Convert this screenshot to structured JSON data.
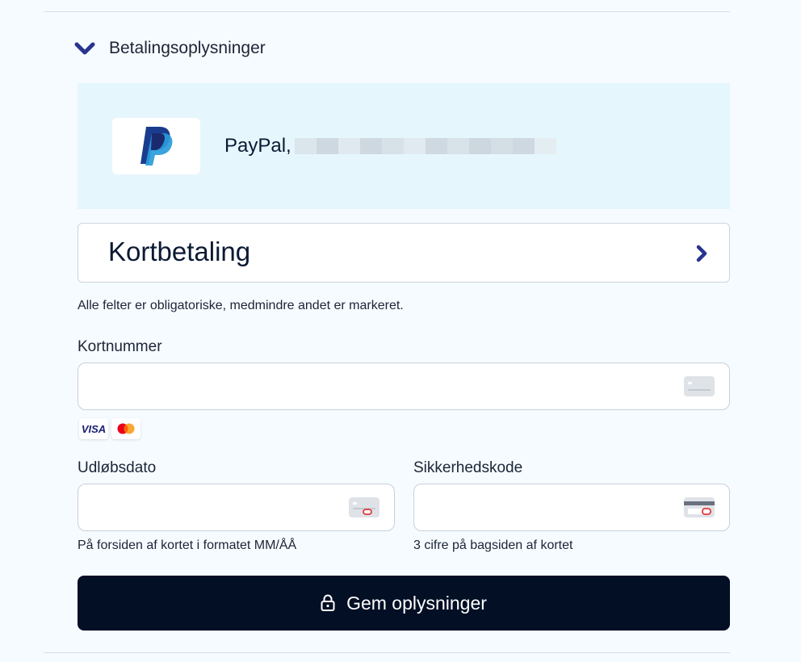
{
  "section": {
    "title": "Betalingsoplysninger"
  },
  "paypal": {
    "label": "PayPal,",
    "logo": "paypal-logo"
  },
  "card_option": {
    "label": "Kortbetaling"
  },
  "required_note": "Alle felter er obligatoriske, medmindre andet er markeret.",
  "card_number": {
    "label": "Kortnummer",
    "value": "",
    "placeholder": ""
  },
  "card_brands": [
    "visa",
    "mastercard"
  ],
  "visa_text": "VISA",
  "expiry": {
    "label": "Udløbsdato",
    "value": "",
    "placeholder": "",
    "hint": "På forsiden af kortet i formatet MM/ÅÅ"
  },
  "cvc": {
    "label": "Sikkerhedskode",
    "value": "",
    "placeholder": "",
    "hint": "3 cifre på bagsiden af kortet"
  },
  "save_button": {
    "label": "Gem oplysninger",
    "icon": "lock-icon"
  },
  "colors": {
    "accent": "#29348f",
    "button_bg": "#030f25",
    "panel_bg": "#e6f6fd",
    "page_bg": "#f6fbff"
  }
}
